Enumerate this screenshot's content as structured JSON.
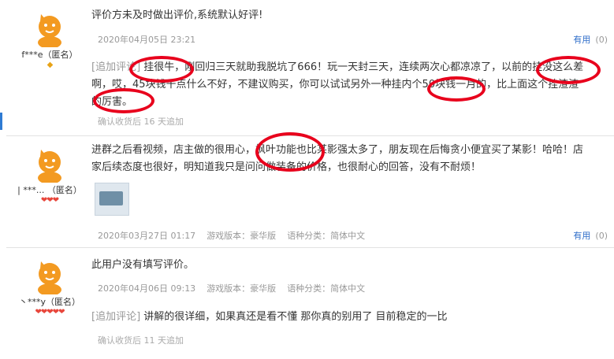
{
  "reviews": [
    {
      "username": "f***e（匿名）",
      "badge": "◆",
      "text": "评价方未及时做出评价,系统默认好评!",
      "date": "2020年04月05日 23:21",
      "useful_label": "有用",
      "useful_count": "(0)",
      "followup_label": "[追加评论]",
      "followup_text": "挂很牛，刚回归三天就助我脱坑了666！玩一天封三天，连续两次心都凉凉了，以前的挂没这么差啊，哎，45块钱干点什么不好，不建议购买，你可以试试另外一种挂内个50块钱一月的，比上面这个挂渣渣的厉害。",
      "followup_date": "确认收货后 16 天追加"
    },
    {
      "username": "| ***... （匿名）",
      "badge": "❤❤❤",
      "text": "进群之后看视频，店主做的很用心，枫叶功能也比某影强太多了，朋友现在后悔贪小便宜买了某影！哈哈！店家后续态度也很好，明知道我只是问问做装备的价格，也很耐心的回答，没有不耐烦！",
      "date": "2020年03月27日 01:17",
      "version": "游戏版本：豪华版",
      "language": "语种分类：简体中文",
      "useful_label": "有用",
      "useful_count": "(0)"
    },
    {
      "username": "丶***y（匿名）",
      "badge": "❤❤❤❤❤",
      "text": "此用户没有填写评价。",
      "date": "2020年04月06日 09:13",
      "version": "游戏版本：豪华版",
      "language": "语种分类：简体中文",
      "followup_label": "[追加评论]",
      "followup_text": "讲解的很详细，如果真还是看不懂 那你真的别用了 目前稳定的一比",
      "followup_date": "确认收货后 11 天追加"
    }
  ],
  "colors": {
    "link": "#2f6ec9",
    "annotation": "#e8001c",
    "avatar": "#f39a21"
  },
  "icons": {
    "avatar": "orange-mascot-avatar-icon"
  }
}
